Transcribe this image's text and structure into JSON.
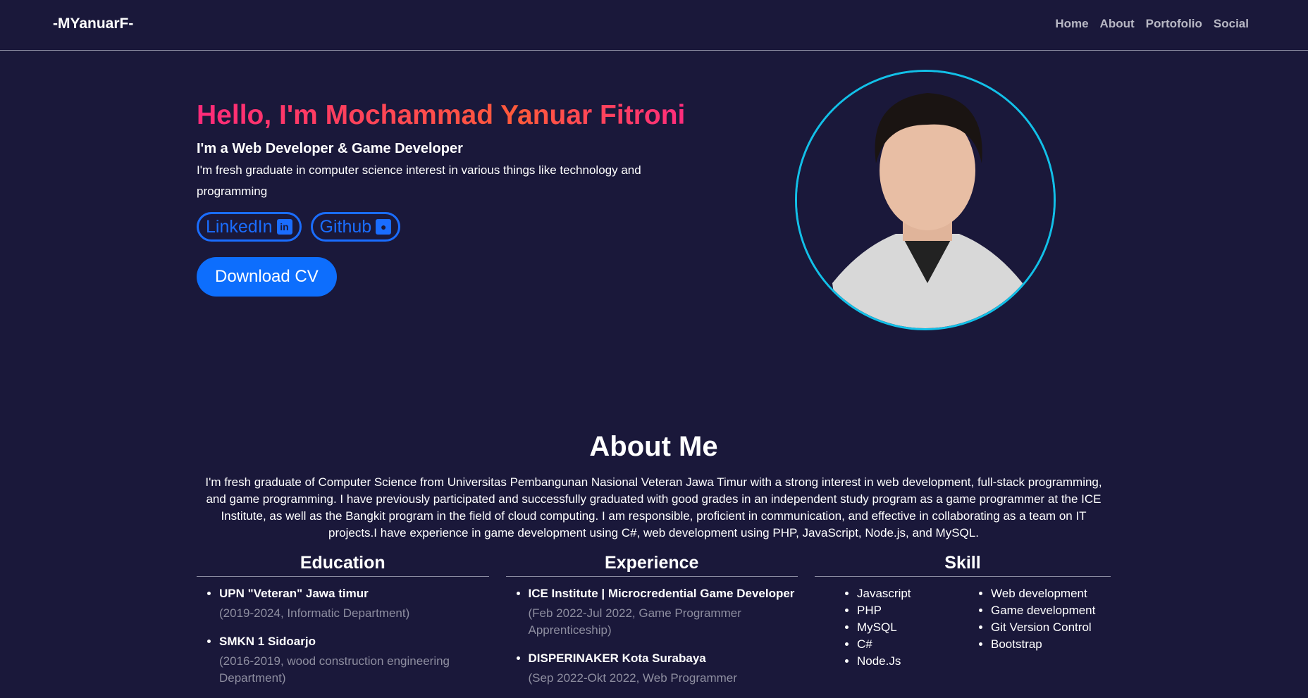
{
  "nav": {
    "logo": "-MYanuarF-",
    "links": [
      "Home",
      "About",
      "Portofolio",
      "Social"
    ]
  },
  "hero": {
    "title": "Hello, I'm Mochammad Yanuar Fitroni",
    "subtitle": "I'm a Web Developer & Game Developer",
    "description": "I'm fresh graduate in computer science interest in various things like technology and programming",
    "linkedin": "LinkedIn",
    "github": "Github",
    "download": "Download CV"
  },
  "about": {
    "heading": "About Me",
    "text": "I'm fresh graduate of Computer Science from Universitas Pembangunan Nasional Veteran Jawa Timur with a strong interest in web development, full-stack programming, and game programming. I have previously participated and successfully graduated with good grades in an independent study program as a game programmer at the ICE Institute, as well as the Bangkit program in the field of cloud computing. I am responsible, proficient in communication, and effective in collaborating as a team on IT projects.I have experience in game development using C#, web development using PHP, JavaScript, Node.js, and MySQL."
  },
  "education": {
    "heading": "Education",
    "items": [
      {
        "name": "UPN \"Veteran\" Jawa timur",
        "detail": "(2019-2024, Informatic Department)"
      },
      {
        "name": "SMKN 1 Sidoarjo",
        "detail": "(2016-2019, wood construction engineering Department)"
      }
    ]
  },
  "experience": {
    "heading": "Experience",
    "items": [
      {
        "name": "ICE Institute | Microcredential Game Developer",
        "detail": "(Feb 2022-Jul 2022, Game Programmer Apprenticeship)"
      },
      {
        "name": "DISPERINAKER Kota Surabaya",
        "detail": "(Sep 2022-Okt 2022, Web Programmer"
      }
    ]
  },
  "skill": {
    "heading": "Skill",
    "col1": [
      "Javascript",
      "PHP",
      "MySQL",
      "C#",
      "Node.Js"
    ],
    "col2": [
      "Web development",
      "Game development",
      "Git Version Control",
      "Bootstrap"
    ]
  },
  "colors": {
    "bg": "#1a183a",
    "accent": "#0d6efd",
    "ring": "#12c0e8"
  }
}
